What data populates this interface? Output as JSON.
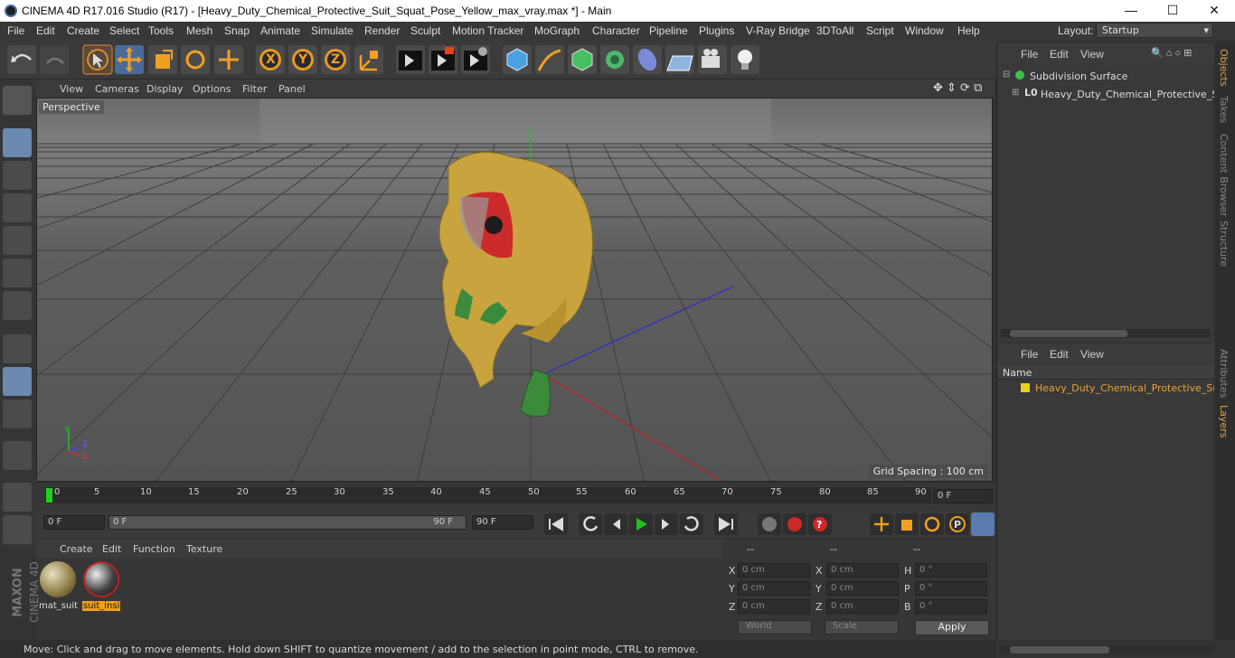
{
  "window": {
    "title": "CINEMA 4D R17.016 Studio (R17) - [Heavy_Duty_Chemical_Protective_Suit_Squat_Pose_Yellow_max_vray.max *] - Main",
    "minimize": "—",
    "maximize": "☐",
    "close": "✕"
  },
  "menu": [
    "File",
    "Edit",
    "Create",
    "Select",
    "Tools",
    "Mesh",
    "Snap",
    "Animate",
    "Simulate",
    "Render",
    "Sculpt",
    "Motion Tracker",
    "MoGraph",
    "Character",
    "Pipeline",
    "Plugins",
    "V-Ray Bridge",
    "3DToAll",
    "Script",
    "Window",
    "Help"
  ],
  "layout": {
    "label": "Layout:",
    "value": "Startup"
  },
  "toolbar": {
    "icons": [
      "undo-icon",
      "redo-icon",
      "select-pointer-icon",
      "move-icon",
      "scale-icon",
      "rotate-icon",
      "live-move-icon",
      "x-axis-icon",
      "y-axis-icon",
      "z-axis-icon",
      "coordinate-system-icon",
      "render-view-icon",
      "render-picture-viewer-icon",
      "render-settings-icon",
      "cube-primitive-icon",
      "pen-spline-icon",
      "subdivision-icon",
      "cloner-icon",
      "deformer-icon",
      "floor-icon",
      "camera-icon",
      "light-icon"
    ],
    "axis_labels": [
      "X",
      "Y",
      "Z"
    ]
  },
  "viewport": {
    "menu": [
      "View",
      "Cameras",
      "Display",
      "Options",
      "Filter",
      "Panel"
    ],
    "label": "Perspective",
    "grid_spacing": "Grid Spacing : 100 cm",
    "axis_labels": {
      "y": "Y",
      "z": "Z",
      "x": "X"
    }
  },
  "timeline": {
    "ticks": [
      "0",
      "5",
      "10",
      "15",
      "20",
      "25",
      "30",
      "35",
      "40",
      "45",
      "50",
      "55",
      "60",
      "65",
      "70",
      "75",
      "80",
      "85",
      "90"
    ],
    "current_frame": "0 F"
  },
  "transport": {
    "start": "0 F",
    "range_start": "0 F",
    "range_end": "90 F",
    "end": "90 F"
  },
  "materials": {
    "menu": [
      "Create",
      "Edit",
      "Function",
      "Texture"
    ],
    "items": [
      {
        "name": "mat_suit",
        "selected": false
      },
      {
        "name": "suit_insi",
        "selected": true
      }
    ]
  },
  "coords": {
    "headers": [
      "--",
      "--",
      "--"
    ],
    "rows": [
      {
        "a": "X",
        "av": "0 cm",
        "b": "X",
        "bv": "0 cm",
        "c": "H",
        "cv": "0 °"
      },
      {
        "a": "Y",
        "av": "0 cm",
        "b": "Y",
        "bv": "0 cm",
        "c": "P",
        "cv": "0 °"
      },
      {
        "a": "Z",
        "av": "0 cm",
        "b": "Z",
        "bv": "0 cm",
        "c": "B",
        "cv": "0 °"
      }
    ],
    "mode1": "World",
    "mode2": "Scale",
    "apply": "Apply"
  },
  "objects": {
    "menu": [
      "File",
      "Edit",
      "View"
    ],
    "tree": [
      {
        "name": "Subdivision Surface",
        "level": 0
      },
      {
        "name": "Heavy_Duty_Chemical_Protective_Suit_",
        "level": 1
      }
    ]
  },
  "layers": {
    "menu": [
      "File",
      "Edit",
      "View"
    ],
    "header": "Name",
    "items": [
      "Heavy_Duty_Chemical_Protective_Suit_S"
    ]
  },
  "sidetabs_top": [
    "Objects",
    "Takes",
    "Content Browser",
    "Structure"
  ],
  "sidetabs_bottom": [
    "Attributes",
    "Layers"
  ],
  "brand": {
    "line1": "MAXON",
    "line2": "CINEMA 4D"
  },
  "status": "Move: Click and drag to move elements. Hold down SHIFT to quantize movement / add to the selection in point mode, CTRL to remove.",
  "colors": {
    "accent": "#e8a23a",
    "suit": "#c9a43e",
    "gloves": "#3c8a3c",
    "layer_dot": "#e6d21e"
  }
}
